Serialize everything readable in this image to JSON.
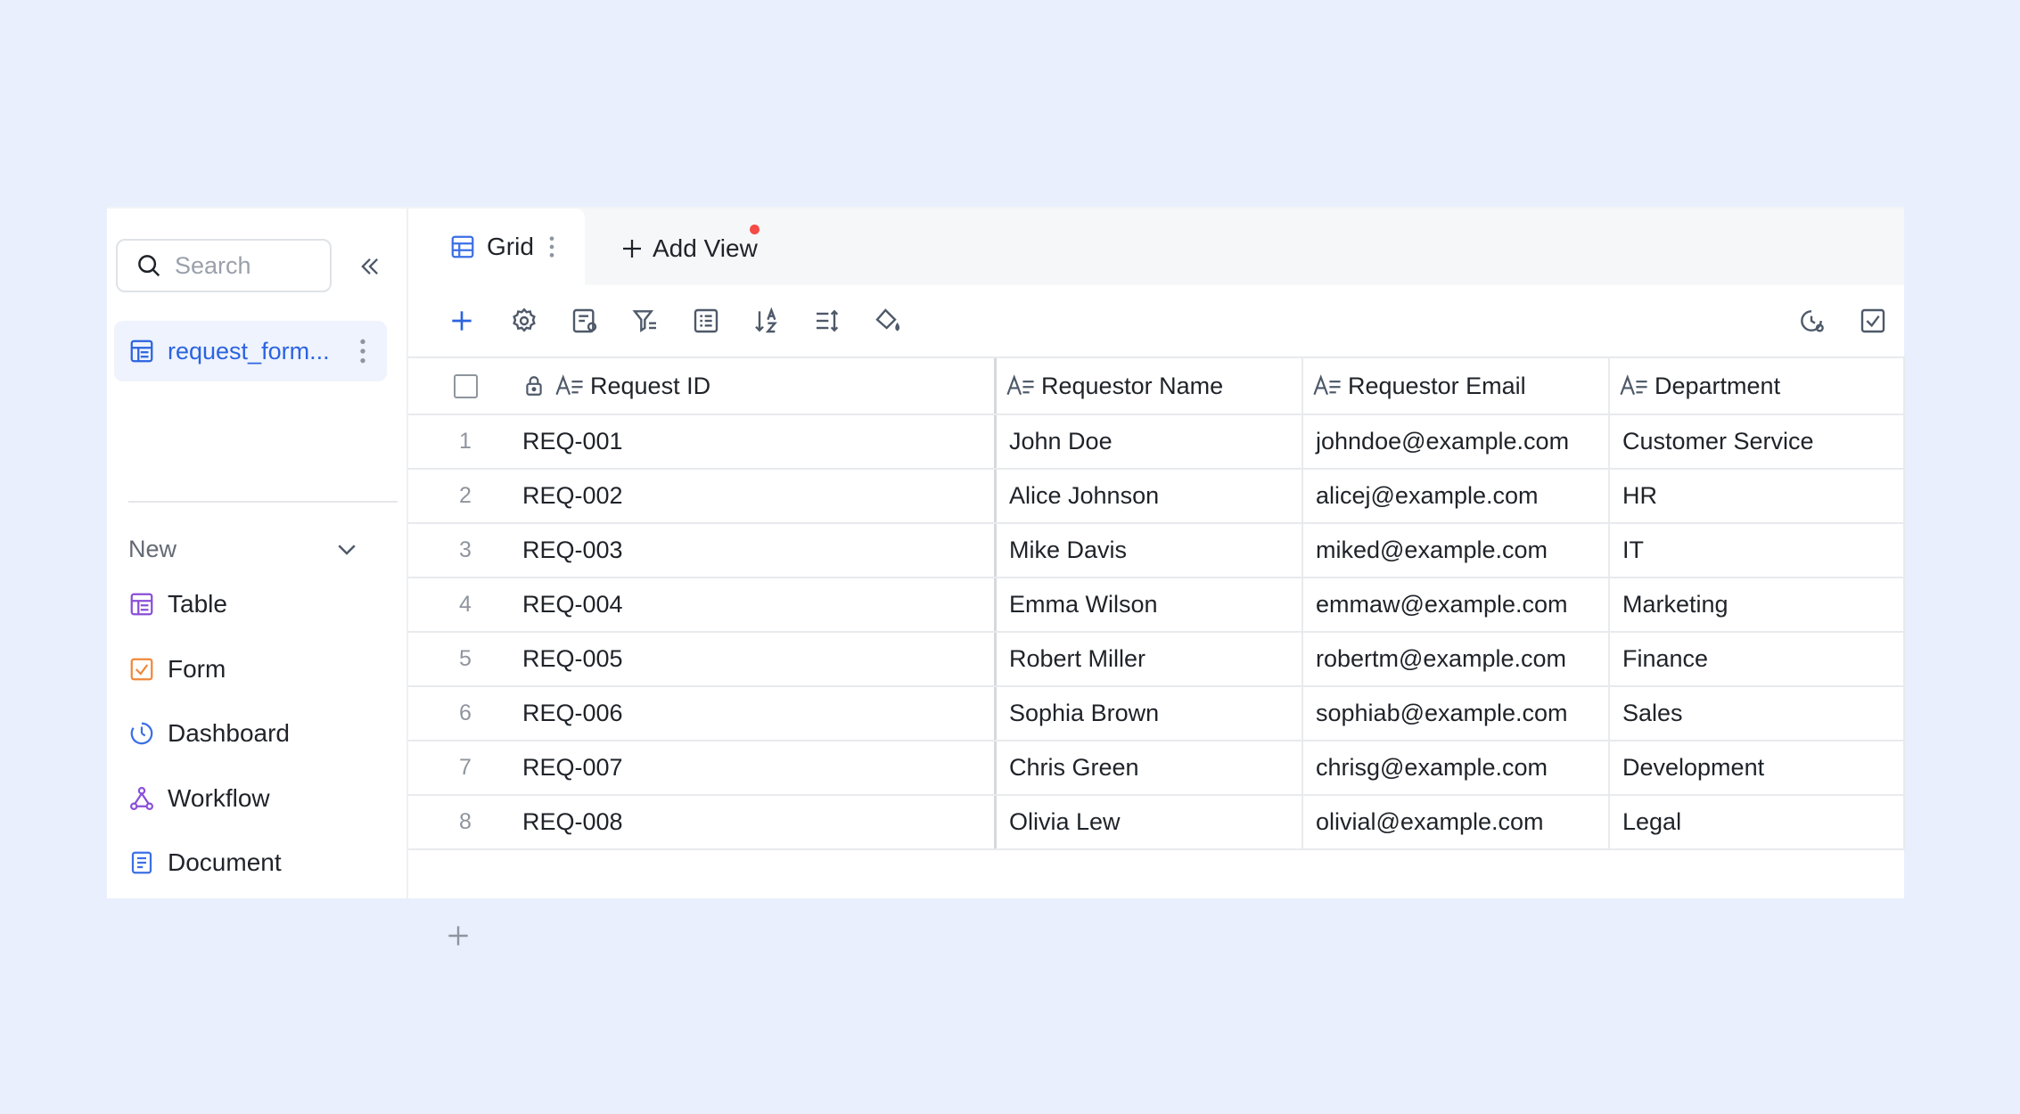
{
  "sidebar": {
    "search_placeholder": "Search",
    "table_item_label": "request_form...",
    "new_label": "New",
    "nav_items": [
      {
        "label": "Table",
        "icon": "table-icon",
        "color": "#8a4fd8"
      },
      {
        "label": "Form",
        "icon": "form-icon",
        "color": "#f0883a"
      },
      {
        "label": "Dashboard",
        "icon": "dashboard-icon",
        "color": "#3b6fe6"
      },
      {
        "label": "Workflow",
        "icon": "workflow-icon",
        "color": "#8a4fd8"
      },
      {
        "label": "Document",
        "icon": "document-icon",
        "color": "#3b6fe6"
      }
    ]
  },
  "tabs": {
    "grid_label": "Grid",
    "add_view_label": "Add View"
  },
  "grid": {
    "columns": [
      "Request ID",
      "Requestor Name",
      "Requestor Email",
      "Department"
    ],
    "rows": [
      {
        "num": "1",
        "id": "REQ-001",
        "name": "John Doe",
        "email": "johndoe@example.com",
        "dept": "Customer Service"
      },
      {
        "num": "2",
        "id": "REQ-002",
        "name": "Alice Johnson",
        "email": "alicej@example.com",
        "dept": "HR"
      },
      {
        "num": "3",
        "id": "REQ-003",
        "name": "Mike Davis",
        "email": "miked@example.com",
        "dept": "IT"
      },
      {
        "num": "4",
        "id": "REQ-004",
        "name": "Emma Wilson",
        "email": "emmaw@example.com",
        "dept": "Marketing"
      },
      {
        "num": "5",
        "id": "REQ-005",
        "name": "Robert Miller",
        "email": "robertm@example.com",
        "dept": "Finance"
      },
      {
        "num": "6",
        "id": "REQ-006",
        "name": "Sophia Brown",
        "email": "sophiab@example.com",
        "dept": "Sales"
      },
      {
        "num": "7",
        "id": "REQ-007",
        "name": "Chris Green",
        "email": "chrisg@example.com",
        "dept": "Development"
      },
      {
        "num": "8",
        "id": "REQ-008",
        "name": "Olivia Lew",
        "email": "olivial@example.com",
        "dept": "Legal"
      }
    ]
  },
  "colors": {
    "accent": "#2b63e0",
    "selected_bg": "#eef3fd",
    "page_bg": "#e9effc"
  }
}
